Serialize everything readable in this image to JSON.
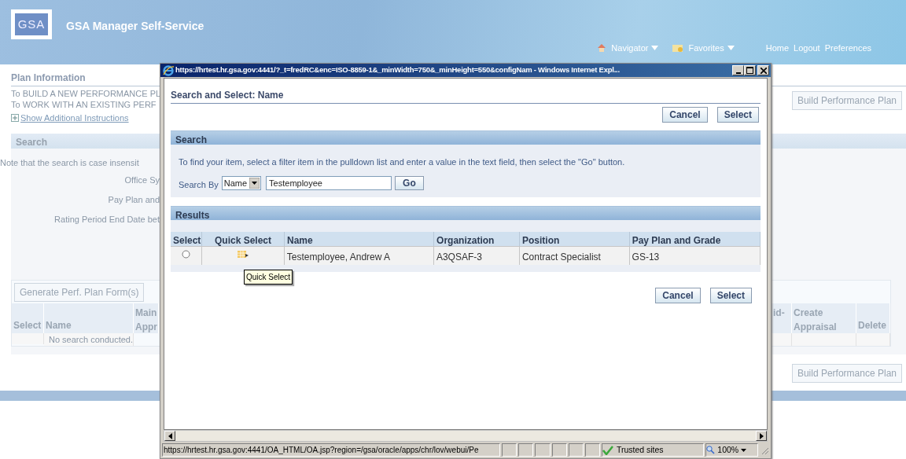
{
  "app": {
    "logo": "GSA",
    "title": "GSA Manager Self-Service",
    "nav": [
      {
        "kind": "navigator",
        "label": "Navigator"
      },
      {
        "kind": "favorites",
        "label": "Favorites"
      }
    ],
    "links": [
      "Home",
      "Logout",
      "Preferences"
    ]
  },
  "page": {
    "section_title": "Plan Information",
    "instructions": [
      "To BUILD A NEW PERFORMANCE PL",
      "To WORK WITH AN EXISTING PERF"
    ],
    "expand_link": "Show Additional Instructions",
    "search_header": "Search",
    "note": "Note that the search is case insensit",
    "field_labels": [
      "Office Sy",
      "Pay Plan and",
      "Rating Period End Date bet"
    ],
    "generate_button": "Generate Perf. Plan Form(s)",
    "build_buttons": [
      "Build Performance Plan",
      "Build Performance Plan"
    ],
    "table": {
      "columns_left": [
        "Select",
        "Name",
        "Main Appr"
      ],
      "columns_right": [
        "id-",
        "Create Appraisal",
        "Delete"
      ],
      "empty_message": "No search conducted."
    }
  },
  "popup": {
    "window_title": "https://hrtest.hr.gsa.gov:4441/?_t=fredRC&enc=ISO-8859-1&_minWidth=750&_minHeight=550&configNam - Windows Internet Expl...",
    "heading": "Search and Select: Name",
    "top_buttons": [
      "Cancel",
      "Select"
    ],
    "search": {
      "header": "Search",
      "instructions": "To find your item, select a filter item in the pulldown list and enter a value in the text field, then select the \"Go\" button.",
      "search_by_label": "Search By",
      "filter": "Name",
      "value": "Testemployee",
      "go": "Go"
    },
    "results": {
      "header": "Results",
      "columns": [
        "Select",
        "Quick Select",
        "Name",
        "Organization",
        "Position",
        "Pay Plan and Grade"
      ],
      "rows": [
        {
          "selected": false,
          "name": "Testemployee, Andrew A",
          "organization": "A3QSAF-3",
          "position": "Contract Specialist",
          "pay_plan_grade": "GS-13"
        }
      ]
    },
    "tooltip": "Quick Select",
    "bottom_buttons": [
      "Cancel",
      "Select"
    ],
    "status_bar": {
      "url": "https://hrtest.hr.gsa.gov:4441/OA_HTML/OA.jsp?region=/gsa/oracle/apps/chr/lov/webui/Pe",
      "zone": "Trusted sites",
      "zoom": "100%"
    }
  }
}
